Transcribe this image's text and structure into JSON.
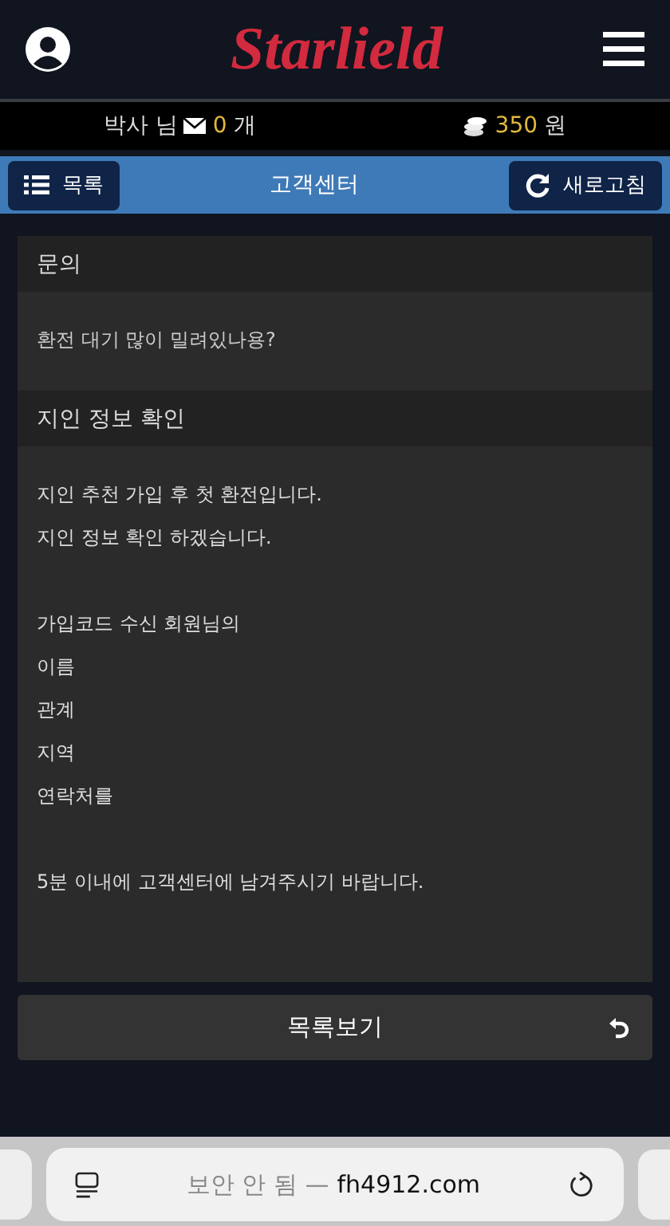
{
  "header": {
    "logo": "Starlield"
  },
  "user_bar": {
    "user": "박사 님",
    "messages": "0",
    "messages_unit": "개",
    "points": "350",
    "points_unit": "원"
  },
  "nav": {
    "menu_button": "목록",
    "title": "고객센터",
    "refresh_button": "새로고침"
  },
  "question": {
    "heading": "문의",
    "text": "환전 대기 많이 밀려있나용?"
  },
  "answer": {
    "heading": "지인 정보 확인",
    "blocks": [
      [
        "지인 추천 가입 후 첫 환전입니다.",
        "지인 정보 확인 하겠습니다."
      ],
      [
        "가입코드 수신 회원님의",
        "이름",
        "관계",
        "지역",
        "연락처를"
      ],
      [
        "5분 이내에 고객센터에 남겨주시기 바랍니다."
      ]
    ]
  },
  "list_button": "목록보기",
  "browser_bar": {
    "security": "보안 안 됨 —",
    "domain": "fh4912.com"
  }
}
